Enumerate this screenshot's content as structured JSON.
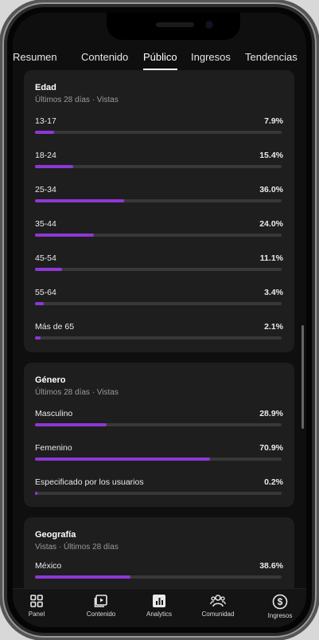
{
  "tabs": [
    {
      "label": "Resumen"
    },
    {
      "label": "Contenido"
    },
    {
      "label": "Público"
    },
    {
      "label": "Ingresos"
    },
    {
      "label": "Tendencias"
    }
  ],
  "age": {
    "title": "Edad",
    "subtitle": "Últimos 28 días · Vistas",
    "rows": [
      {
        "label": "13-17",
        "value": "7.9%",
        "fraction": 0.079
      },
      {
        "label": "18-24",
        "value": "15.4%",
        "fraction": 0.154
      },
      {
        "label": "25-34",
        "value": "36.0%",
        "fraction": 0.36
      },
      {
        "label": "35-44",
        "value": "24.0%",
        "fraction": 0.24
      },
      {
        "label": "45-54",
        "value": "11.1%",
        "fraction": 0.111
      },
      {
        "label": "55-64",
        "value": "3.4%",
        "fraction": 0.034
      },
      {
        "label": "Más de 65",
        "value": "2.1%",
        "fraction": 0.021
      }
    ]
  },
  "gender": {
    "title": "Género",
    "subtitle": "Últimos 28 días · Vistas",
    "rows": [
      {
        "label": "Masculino",
        "value": "28.9%",
        "fraction": 0.289
      },
      {
        "label": "Femenino",
        "value": "70.9%",
        "fraction": 0.709
      },
      {
        "label": "Especificado por los usuarios",
        "value": "0.2%",
        "fraction": 0.002
      }
    ]
  },
  "geo": {
    "title": "Geografía",
    "subtitle": "Vistas · Últimos 28 días",
    "rows": [
      {
        "label": "México",
        "value": "38.6%",
        "fraction": 0.386
      }
    ]
  },
  "nav": [
    {
      "label": "Panel",
      "icon": "dashboard-icon"
    },
    {
      "label": "Contenido",
      "icon": "video-icon"
    },
    {
      "label": "Analytics",
      "icon": "analytics-icon"
    },
    {
      "label": "Comunidad",
      "icon": "community-icon"
    },
    {
      "label": "Ingresos",
      "icon": "dollar-icon"
    }
  ],
  "colors": {
    "accent": "#8e37d6",
    "background": "#0f0f0f",
    "card": "#1e1e1e",
    "track": "#383838"
  }
}
